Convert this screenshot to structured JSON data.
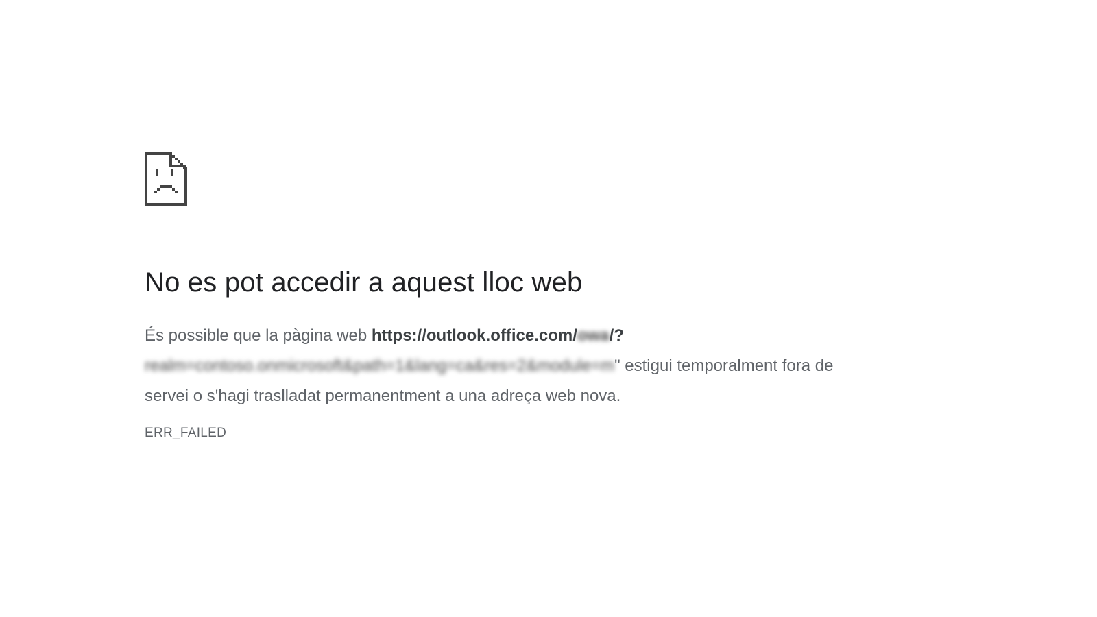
{
  "error_page": {
    "title": "No es pot accedir a aquest lloc web",
    "description": {
      "prefix": "És possible que la pàgina web ",
      "url_visible": "https://outlook.office.com/",
      "url_obscured_1": "owa",
      "url_sep": "/?",
      "url_obscured_2": "realm=contoso.onmicrosoft&path=1&lang=ca&res=2&module=m",
      "url_tail": "\"",
      "suffix": " estigui temporalment fora de servei o s'hagi traslladat permanentment a una adreça web nova."
    },
    "error_code": "ERR_FAILED",
    "icon": "sad-document-icon",
    "colors": {
      "title": "#202124",
      "text": "#5f6368",
      "icon": "#3c4043"
    }
  }
}
